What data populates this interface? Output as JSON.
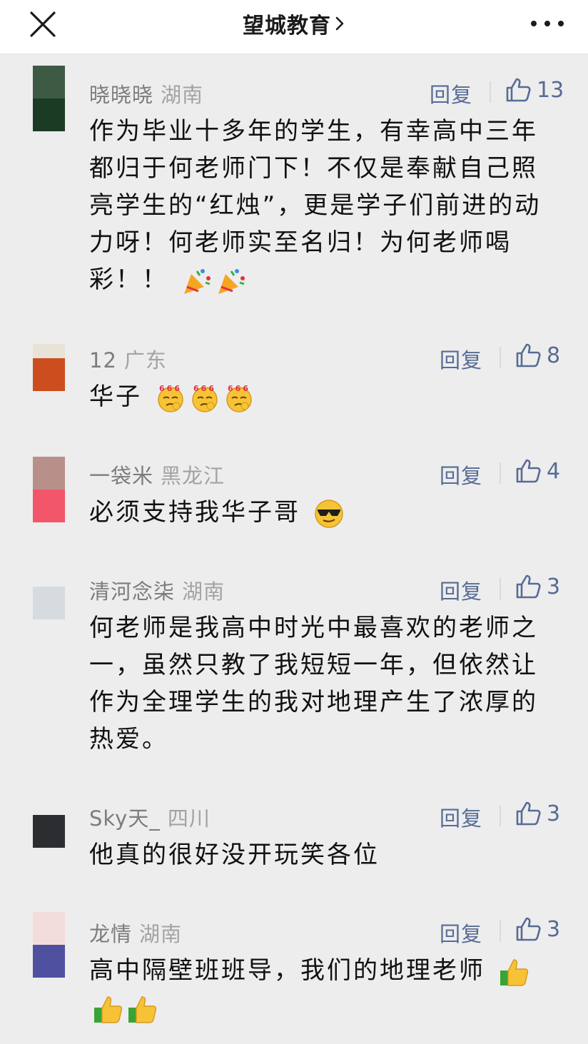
{
  "header": {
    "title": "望城教育",
    "close_icon": "close-icon",
    "more_icon": "more-dots-icon"
  },
  "colors": {
    "link": "#576b95",
    "name": "#7c7c7c",
    "region": "#a3a3a3",
    "background": "#ededed"
  },
  "comments": [
    {
      "name": "晓晓晓",
      "region": "湖南",
      "reply": "回复",
      "likes": "13",
      "text": "作为毕业十多年的学生，有幸高中三年都归于何老师门下！不仅是奉献自己照亮学生的“红烛”，更是学子们前进的动力呀！何老师实至名归！为何老师喝彩！！",
      "emoji": [
        "party-popper-icon",
        "party-popper-icon"
      ]
    },
    {
      "name": "12",
      "region": "广东",
      "reply": "回复",
      "likes": "8",
      "text": "华子",
      "emoji": [
        "666-face-icon",
        "666-face-icon",
        "666-face-icon"
      ]
    },
    {
      "name": "一袋米",
      "region": "黑龙江",
      "reply": "回复",
      "likes": "4",
      "text": "必须支持我华子哥",
      "emoji": [
        "sunglasses-face-icon"
      ]
    },
    {
      "name": "清河念柒",
      "region": "湖南",
      "reply": "回复",
      "likes": "3",
      "text": "何老师是我高中时光中最喜欢的老师之一，虽然只教了我短短一年，但依然让作为全理学生的我对地理产生了浓厚的热爱。",
      "emoji": []
    },
    {
      "name": "Sky天_",
      "region": "四川",
      "reply": "回复",
      "likes": "3",
      "text": "他真的很好没开玩笑各位",
      "emoji": []
    },
    {
      "name": "龙情",
      "region": "湖南",
      "reply": "回复",
      "likes": "3",
      "text": "高中隔壁班班导，我们的地理老师",
      "emoji": [
        "thumbs-up-icon",
        "thumbs-up-icon",
        "thumbs-up-icon"
      ]
    }
  ]
}
